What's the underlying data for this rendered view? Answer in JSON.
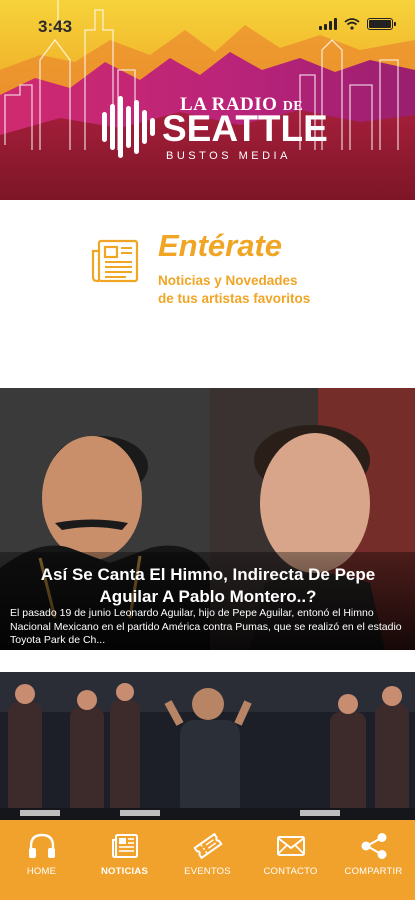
{
  "status_bar": {
    "time": "3:43"
  },
  "header": {
    "logo_top": "LA RADIO",
    "logo_de": "DE",
    "logo_main": "SEATTLE",
    "logo_sub": "BUSTOS MEDIA"
  },
  "section": {
    "title": "Entérate",
    "subtitle_line1": "Noticias y Novedades",
    "subtitle_line2": "de tus artistas favoritos",
    "icon": "newspaper-icon"
  },
  "articles": [
    {
      "title_line1": "Así Se Canta El Himno, Indirecta De Pepe",
      "title_line2": "Aguilar A Pablo Montero..?",
      "excerpt": "El pasado 19 de junio Leonardo Aguilar, hijo de Pepe Aguilar, entonó el Himno Nacional Mexicano en el partido América contra Pumas, que se realizó en el estadio Toyota Park de Ch..."
    },
    {
      "title_line1": "",
      "excerpt": ""
    }
  ],
  "tabs": [
    {
      "label": "HOME",
      "icon": "headphones-icon",
      "active": false
    },
    {
      "label": "NOTICIAS",
      "icon": "newspaper-icon",
      "active": true
    },
    {
      "label": "EVENTOS",
      "icon": "ticket-icon",
      "active": false
    },
    {
      "label": "CONTACTO",
      "icon": "mail-icon",
      "active": false
    },
    {
      "label": "COMPARTIR",
      "icon": "share-icon",
      "active": false
    }
  ],
  "colors": {
    "accent": "#f0a525",
    "tabbar": "#f0a22c",
    "header_dark": "#8f1b2b",
    "header_magenta": "#c2267a",
    "header_yellow": "#f3c52d"
  }
}
